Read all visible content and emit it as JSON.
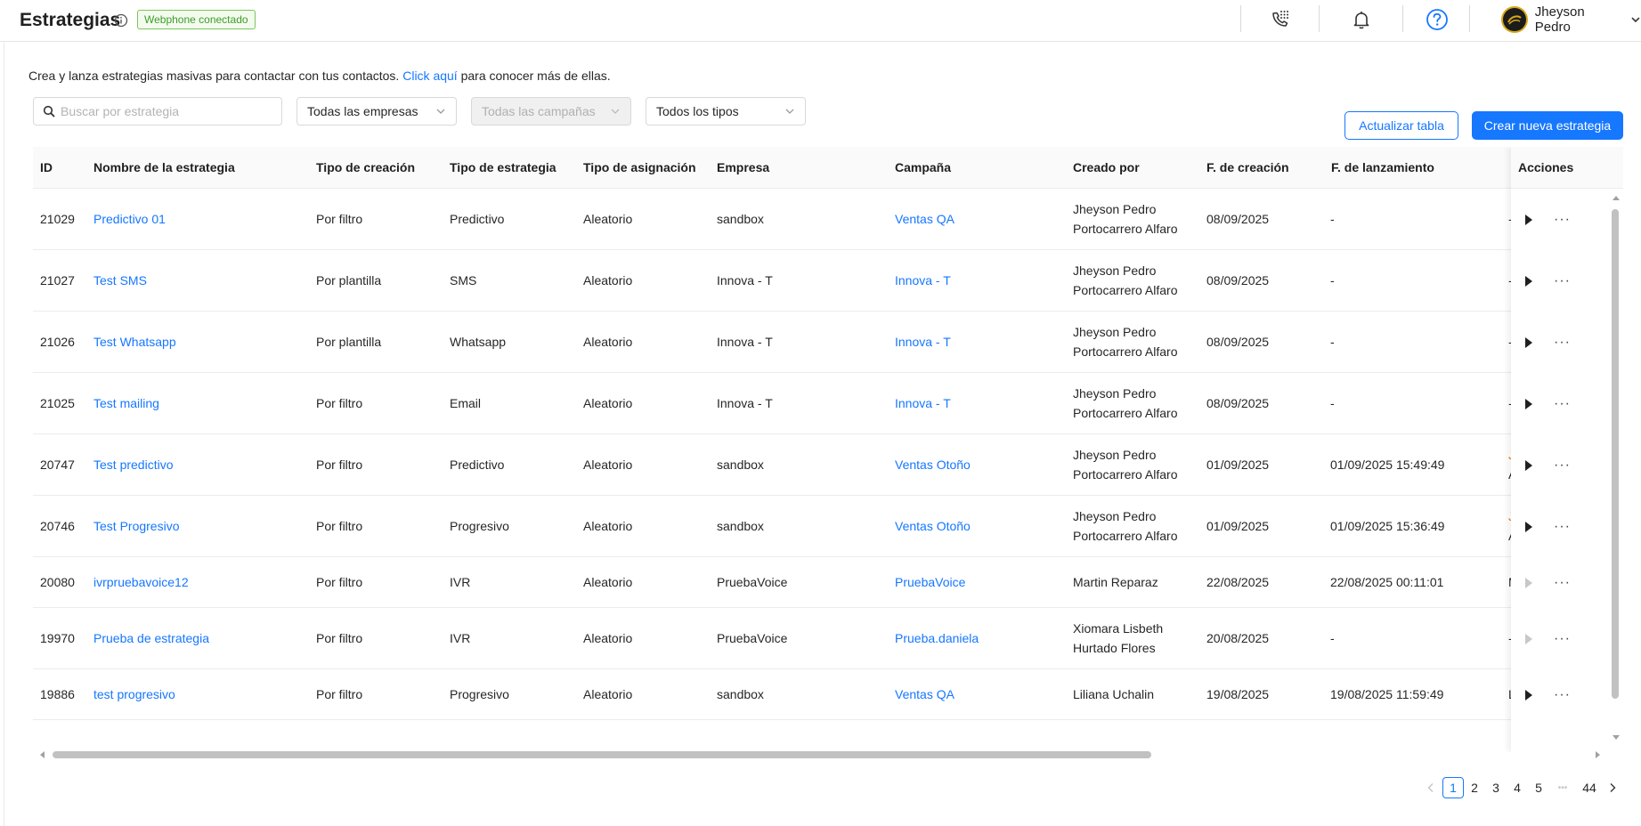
{
  "header": {
    "title": "Estrategias",
    "badge": "Webphone conectado",
    "user_name": "Jheyson Pedro"
  },
  "intro": {
    "text": "Crea y lanza estrategias masivas para contactar con tus contactos.",
    "link": "Click aquí",
    "suffix": "para conocer más de ellas."
  },
  "filters": {
    "search_placeholder": "Buscar por estrategia",
    "company": "Todas las empresas",
    "campaign": "Todas las campañas",
    "type": "Todos los tipos"
  },
  "buttons": {
    "refresh": "Actualizar tabla",
    "create": "Crear nueva estrategia"
  },
  "table": {
    "columns": [
      "ID",
      "Nombre de la estrategia",
      "Tipo de creación",
      "Tipo de estrategia",
      "Tipo de asignación",
      "Empresa",
      "Campaña",
      "Creado por",
      "F. de creación",
      "F. de lanzamiento",
      "Acciones"
    ],
    "rows": [
      {
        "id": "21029",
        "name": "Predictivo 01",
        "creation": "Por filtro",
        "strategy": "Predictivo",
        "assign": "Aleatorio",
        "company": "sandbox",
        "campaign": "Ventas QA",
        "by1": "Jheyson Pedro",
        "by2": "Portocarrero Alfaro",
        "created": "08/09/2025",
        "launched": "-",
        "extra1": "-",
        "extra2": ""
      },
      {
        "id": "21027",
        "name": "Test SMS",
        "creation": "Por plantilla",
        "strategy": "SMS",
        "assign": "Aleatorio",
        "company": "Innova - T",
        "campaign": "Innova - T",
        "by1": "Jheyson Pedro",
        "by2": "Portocarrero Alfaro",
        "created": "08/09/2025",
        "launched": "-",
        "extra1": "-",
        "extra2": ""
      },
      {
        "id": "21026",
        "name": "Test Whatsapp",
        "creation": "Por plantilla",
        "strategy": "Whatsapp",
        "assign": "Aleatorio",
        "company": "Innova - T",
        "campaign": "Innova - T",
        "by1": "Jheyson Pedro",
        "by2": "Portocarrero Alfaro",
        "created": "08/09/2025",
        "launched": "-",
        "extra1": "-",
        "extra2": ""
      },
      {
        "id": "21025",
        "name": "Test mailing",
        "creation": "Por filtro",
        "strategy": "Email",
        "assign": "Aleatorio",
        "company": "Innova - T",
        "campaign": "Innova - T",
        "by1": "Jheyson Pedro",
        "by2": "Portocarrero Alfaro",
        "created": "08/09/2025",
        "launched": "-",
        "extra1": "-",
        "extra2": ""
      },
      {
        "id": "20747",
        "name": "Test predictivo",
        "creation": "Por filtro",
        "strategy": "Predictivo",
        "assign": "Aleatorio",
        "company": "sandbox",
        "campaign": "Ventas Otoño",
        "by1": "Jheyson Pedro",
        "by2": "Portocarrero Alfaro",
        "created": "01/09/2025",
        "launched": "01/09/2025 15:49:49",
        "extra1": "J",
        "extra2": "A"
      },
      {
        "id": "20746",
        "name": "Test Progresivo",
        "creation": "Por filtro",
        "strategy": "Progresivo",
        "assign": "Aleatorio",
        "company": "sandbox",
        "campaign": "Ventas Otoño",
        "by1": "Jheyson Pedro",
        "by2": "Portocarrero Alfaro",
        "created": "01/09/2025",
        "launched": "01/09/2025 15:36:49",
        "extra1": "J",
        "extra2": "A"
      },
      {
        "id": "20080",
        "name": "ivrpruebavoice12",
        "creation": "Por filtro",
        "strategy": "IVR",
        "assign": "Aleatorio",
        "company": "PruebaVoice",
        "campaign": "PruebaVoice",
        "by1": "Martin Reparaz",
        "by2": "",
        "created": "22/08/2025",
        "launched": "22/08/2025 00:11:01",
        "extra1": "M",
        "extra2": ""
      },
      {
        "id": "19970",
        "name": "Prueba de estrategia",
        "creation": "Por filtro",
        "strategy": "IVR",
        "assign": "Aleatorio",
        "company": "PruebaVoice",
        "campaign": "Prueba.daniela",
        "by1": "Xiomara Lisbeth",
        "by2": "Hurtado Flores",
        "created": "20/08/2025",
        "launched": "-",
        "extra1": "-",
        "extra2": ""
      },
      {
        "id": "19886",
        "name": "test progresivo",
        "creation": "Por filtro",
        "strategy": "Progresivo",
        "assign": "Aleatorio",
        "company": "sandbox",
        "campaign": "Ventas QA",
        "by1": "Liliana Uchalin",
        "by2": "",
        "created": "19/08/2025",
        "launched": "19/08/2025 11:59:49",
        "extra1": "L",
        "extra2": ""
      }
    ]
  },
  "pagination": {
    "pages": [
      "1",
      "2",
      "3",
      "4",
      "5"
    ],
    "ellipsis": "•••",
    "last": "44"
  }
}
